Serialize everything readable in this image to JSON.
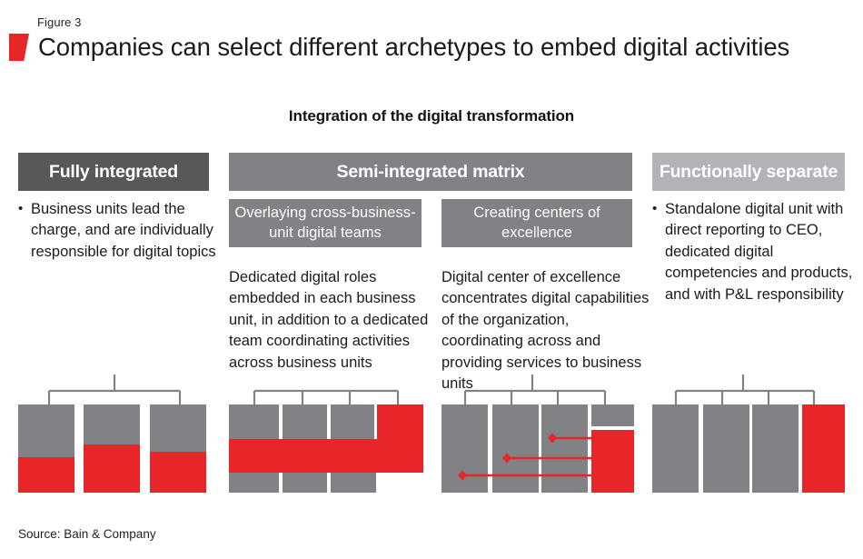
{
  "figure": {
    "label": "Figure 3",
    "title": "Companies can select different archetypes to embed digital activities",
    "accent_color": "#e8262a",
    "gray_dark": "#58585a",
    "gray_mid": "#808285",
    "gray_light": "#b1b3b6",
    "bar_gray": "#808285",
    "bracket_gray": "#808285"
  },
  "chart_subtitle": "Integration of the digital transformation",
  "archetypes": [
    {
      "header": "Fully integrated",
      "header_color": "#58585a",
      "subheaders": [],
      "descriptions": [
        {
          "bulleted": true,
          "text": "Business units lead the charge, and are individually responsible for digital topics"
        }
      ]
    },
    {
      "header": "Semi-integrated matrix",
      "header_color": "#808285",
      "subheaders": [
        "Overlaying cross-business-unit digital teams",
        "Creating centers of excellence"
      ],
      "descriptions": [
        {
          "bulleted": false,
          "text": "Dedicated digital roles embedded in each business unit, in addition to a dedicated team coordinating activities across business units"
        },
        {
          "bulleted": false,
          "text": "Digital center of excellence concentrates digital capabilities of the organization, coordinating across and providing services to business units"
        }
      ]
    },
    {
      "header": "Functionally separate",
      "header_color": "#b1b3b6",
      "subheaders": [],
      "descriptions": [
        {
          "bulleted": true,
          "text": "Standalone digital unit with direct reporting to CEO, dedicated digital competencies and products, and with P&L responsibility"
        }
      ]
    }
  ],
  "source": "Source: Bain & Company",
  "chart_data": {
    "type": "diagram",
    "title": "Integration of the digital transformation",
    "description": "Four org-structure schematics, one per archetype column, showing business-unit bars in gray with digital activity shown in red.",
    "diagrams": [
      {
        "name": "fully-integrated",
        "archetype": "Fully integrated",
        "bracket": {
          "stem": true,
          "drops": [
            0,
            2
          ]
        },
        "units": [
          {
            "index": 0,
            "gray_fraction": 0.62,
            "red_fraction": 0.38,
            "red_position": "bottom"
          },
          {
            "index": 1,
            "gray_fraction": 0.46,
            "red_fraction": 0.54,
            "red_position": "bottom"
          },
          {
            "index": 2,
            "gray_fraction": 0.55,
            "red_fraction": 0.45,
            "red_position": "bottom"
          }
        ]
      },
      {
        "name": "semi-integrated-overlay",
        "archetype": "Semi-integrated matrix / Overlaying cross-business-unit digital teams",
        "bracket": {
          "stem": false,
          "drops": [
            0,
            1,
            2,
            3
          ]
        },
        "units": [
          {
            "index": 0,
            "type": "gray-bar"
          },
          {
            "index": 1,
            "type": "gray-bar"
          },
          {
            "index": 2,
            "type": "gray-bar"
          },
          {
            "index": 3,
            "type": "red-bar-tall"
          }
        ],
        "overlay_band": {
          "color": "#e8262a",
          "orientation": "horizontal",
          "spans_all_units": true
        }
      },
      {
        "name": "semi-integrated-coe",
        "archetype": "Semi-integrated matrix / Creating centers of excellence",
        "bracket": {
          "stem": true,
          "drops": [
            0,
            1,
            2,
            3
          ]
        },
        "units": [
          {
            "index": 0,
            "type": "gray-bar"
          },
          {
            "index": 1,
            "type": "gray-bar"
          },
          {
            "index": 2,
            "type": "gray-bar"
          },
          {
            "index": 3,
            "type": "gray-stub-plus-red-box"
          }
        ],
        "arrows": [
          {
            "from_unit": 2,
            "to": "red-box",
            "level": "upper"
          },
          {
            "from_unit": 1,
            "to": "red-box",
            "level": "middle"
          },
          {
            "from_unit": 0,
            "to": "red-box",
            "level": "lower"
          }
        ],
        "arrow_color": "#e8262a",
        "arrow_head": "diamond"
      },
      {
        "name": "functionally-separate",
        "archetype": "Functionally separate",
        "bracket": {
          "stem": true,
          "drops": [
            0,
            1,
            2,
            3
          ]
        },
        "units": [
          {
            "index": 0,
            "type": "gray-bar"
          },
          {
            "index": 1,
            "type": "gray-bar"
          },
          {
            "index": 2,
            "type": "gray-bar"
          },
          {
            "index": 3,
            "type": "red-bar-full"
          }
        ]
      }
    ]
  }
}
